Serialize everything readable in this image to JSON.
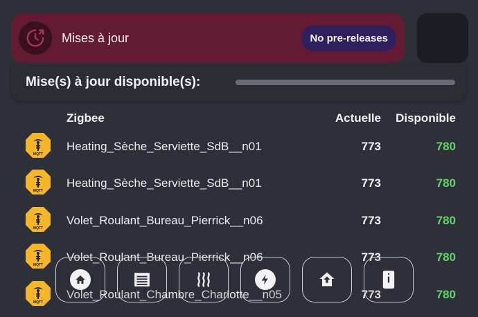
{
  "header": {
    "title": "Mises à jour",
    "prerelease_label": "No pre-releases",
    "icon": "update-clock-icon"
  },
  "available": {
    "title": "Mise(s) à jour disponible(s):"
  },
  "table": {
    "group": "Zigbee",
    "col_current": "Actuelle",
    "col_available": "Disponible",
    "rows": [
      {
        "name": "Heating_Sèche_Serviette_SdB__n01",
        "current": "773",
        "available": "780",
        "icon": "mqtt-icon"
      },
      {
        "name": "Heating_Sèche_Serviette_SdB__n01",
        "current": "773",
        "available": "780",
        "icon": "mqtt-icon"
      },
      {
        "name": "Volet_Roulant_Bureau_Pierrick__n06",
        "current": "773",
        "available": "780",
        "icon": "mqtt-icon"
      },
      {
        "name": "Volet_Roulant_Bureau_Pierrick__n06",
        "current": "773",
        "available": "780",
        "icon": "mqtt-icon"
      },
      {
        "name": "Volet_Roulant_Chambre_Charlotte__n05",
        "current": "773",
        "available": "780",
        "icon": "mqtt-icon"
      }
    ]
  },
  "dock": [
    {
      "icon": "home-icon"
    },
    {
      "icon": "shutter-icon"
    },
    {
      "icon": "heating-icon"
    },
    {
      "icon": "energy-icon"
    },
    {
      "icon": "home-upload-icon"
    },
    {
      "icon": "fridge-icon"
    }
  ],
  "colors": {
    "header_bg": "#631a33",
    "pill_bg": "#2f1f5c",
    "available_green": "#62d46a",
    "mqtt_yellow": "#f5b62a"
  }
}
